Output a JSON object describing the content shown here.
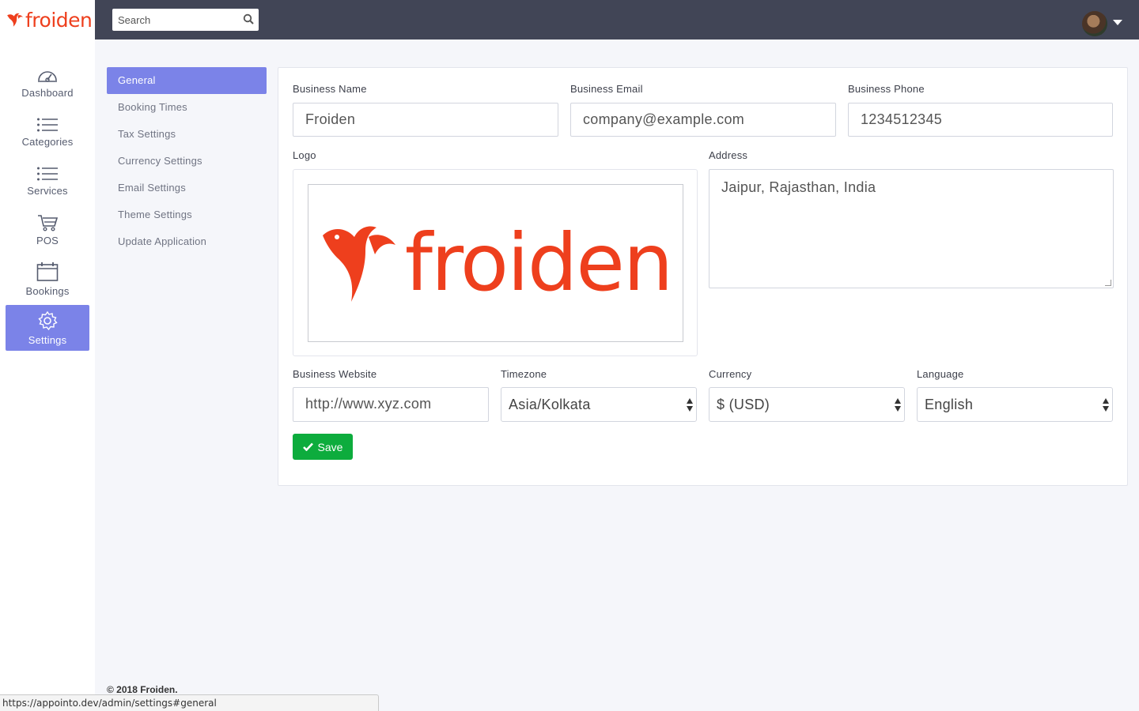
{
  "brand": {
    "name": "froiden",
    "color": "#ee3f1d"
  },
  "search": {
    "placeholder": "Search",
    "icon": "search-icon"
  },
  "user": {
    "avatar": "avatar",
    "menu_icon": "caret-down-icon"
  },
  "nav": {
    "items": [
      {
        "label": "Dashboard",
        "icon": "speedometer-icon",
        "active": false
      },
      {
        "label": "Categories",
        "icon": "list-icon",
        "active": false
      },
      {
        "label": "Services",
        "icon": "list-icon",
        "active": false
      },
      {
        "label": "POS",
        "icon": "cart-icon",
        "active": false
      },
      {
        "label": "Bookings",
        "icon": "calendar-icon",
        "active": false
      },
      {
        "label": "Settings",
        "icon": "gear-icon",
        "active": true
      }
    ]
  },
  "settings_menu": {
    "items": [
      {
        "label": "General",
        "active": true
      },
      {
        "label": "Booking Times",
        "active": false
      },
      {
        "label": "Tax Settings",
        "active": false
      },
      {
        "label": "Currency Settings",
        "active": false
      },
      {
        "label": "Email Settings",
        "active": false
      },
      {
        "label": "Theme Settings",
        "active": false
      },
      {
        "label": "Update Application",
        "active": false
      }
    ]
  },
  "form": {
    "business_name": {
      "label": "Business Name",
      "value": "Froiden"
    },
    "business_email": {
      "label": "Business Email",
      "value": "company@example.com"
    },
    "business_phone": {
      "label": "Business Phone",
      "value": "1234512345"
    },
    "logo": {
      "label": "Logo",
      "image_text": "froiden"
    },
    "address": {
      "label": "Address",
      "value": "Jaipur, Rajasthan, India"
    },
    "business_website": {
      "label": "Business Website",
      "value": "http://www.xyz.com"
    },
    "timezone": {
      "label": "Timezone",
      "value": "Asia/Kolkata"
    },
    "currency": {
      "label": "Currency",
      "value": "$ (USD)"
    },
    "language": {
      "label": "Language",
      "value": "English"
    },
    "save": {
      "label": "Save",
      "icon": "check-icon",
      "color": "#0dac3d"
    }
  },
  "footer": {
    "text": "© 2018 Froiden."
  },
  "status_bar": {
    "url": "https://appointo.dev/admin/settings#general"
  },
  "colors": {
    "accent": "#7b83e8",
    "topbar": "#414556"
  }
}
